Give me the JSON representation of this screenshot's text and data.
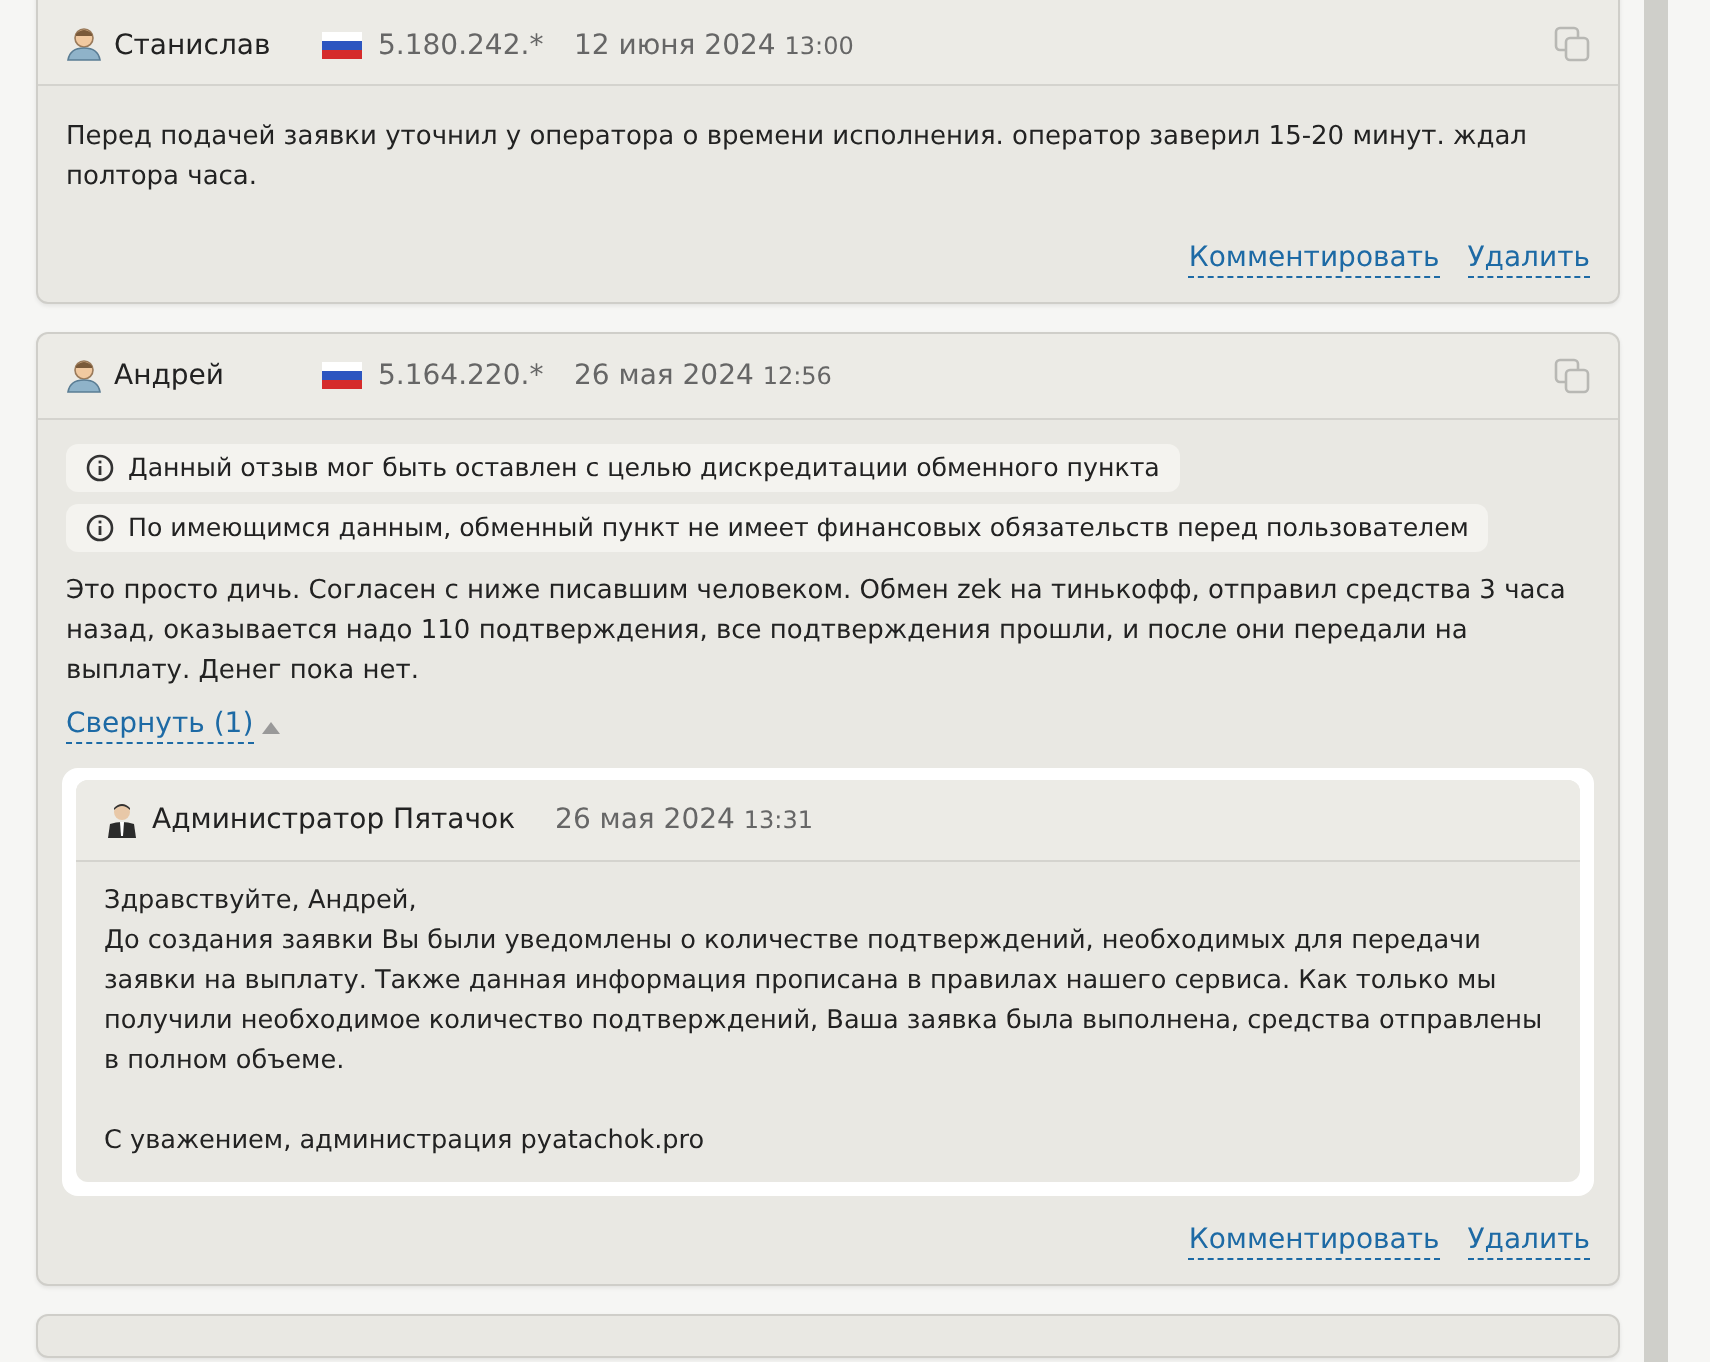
{
  "reviews": [
    {
      "author": "Станислав",
      "ip": "5.180.242.*",
      "date": "12 июня 2024",
      "time": "13:00",
      "text": "Перед подачей заявки уточнил у оператора о времени исполнения. оператор заверил 15-20 минут. ждал полтора часа.",
      "actions": [
        "Комментировать",
        "Удалить"
      ]
    },
    {
      "author": "Андрей",
      "ip": "5.164.220.*",
      "date": "26 мая 2024",
      "time": "12:56",
      "notices": [
        "Данный отзыв мог быть оставлен с целью дискредитации обменного пункта",
        "По имеющимся данным, обменный пункт не имеет финансовых обязательств перед пользователем"
      ],
      "text": "Это просто дичь. Согласен с ниже писавшим человеком. Обмен zek на тинькофф, отправил средства 3 часа назад, оказывается надо 110 подтверждения, все подтверждения прошли, и после они передали на выплату. Денег пока нет.",
      "toggle": {
        "label": "Свернуть (1)",
        "expanded": true
      },
      "replies": [
        {
          "author": "Администратор Пятачок",
          "date": "26 мая 2024",
          "time": "13:31",
          "paragraphs": [
            "Здравствуйте, Андрей,\nДо создания заявки Вы были уведомлены о количестве подтверждений, необходимых для передачи заявки на выплату. Также данная информация прописана в правилах нашего сервиса. Как только мы получили необходимое количество подтверждений, Ваша заявка была выполнена, средства отправлены в полном объеме.",
            "С уважением, администрация pyatachok.pro"
          ]
        }
      ],
      "actions": [
        "Комментировать",
        "Удалить"
      ]
    }
  ]
}
